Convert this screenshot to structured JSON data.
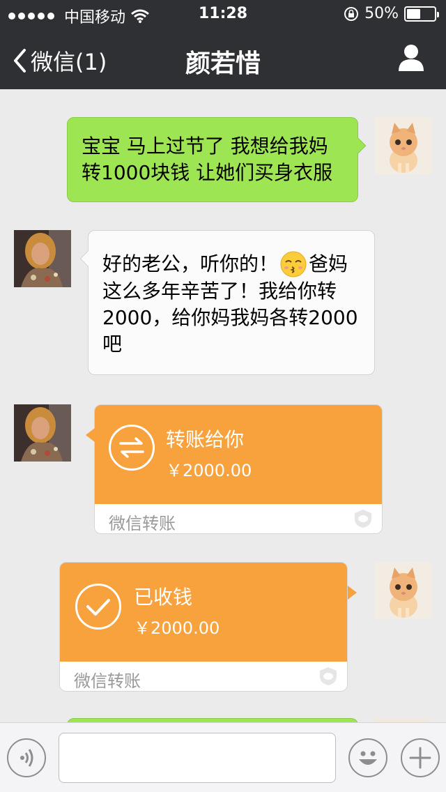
{
  "status_bar": {
    "carrier": "中国移动",
    "time": "11:28",
    "battery": "50%",
    "battery_level": 0.5
  },
  "nav": {
    "back_label": "微信(1)",
    "title": "颜若惜"
  },
  "messages": [
    {
      "sender": "me",
      "text_lines": [
        "宝宝 马上过节了 我想给我妈",
        "转1000块钱 让她们买身衣服"
      ]
    },
    {
      "sender": "other",
      "text_lines": [
        "好的老公，听你的！",
        "这么多年辛苦了！我给你转",
        "2000，给你妈我妈各转2000",
        "吧"
      ],
      "emoji": "kissing-face-icon",
      "text_after_emoji": "爸妈"
    }
  ],
  "transfer_sent": {
    "title": "转账给你",
    "amount": "￥2000.00",
    "footer": "微信转账"
  },
  "transfer_received": {
    "title": "已收钱",
    "amount": "￥2000.00",
    "footer": "微信转账"
  },
  "colors": {
    "nav_bg": "#2f3034",
    "chat_bg": "#ebebeb",
    "green_bubble": "#9ee554",
    "transfer_orange": "#f8a23d"
  }
}
